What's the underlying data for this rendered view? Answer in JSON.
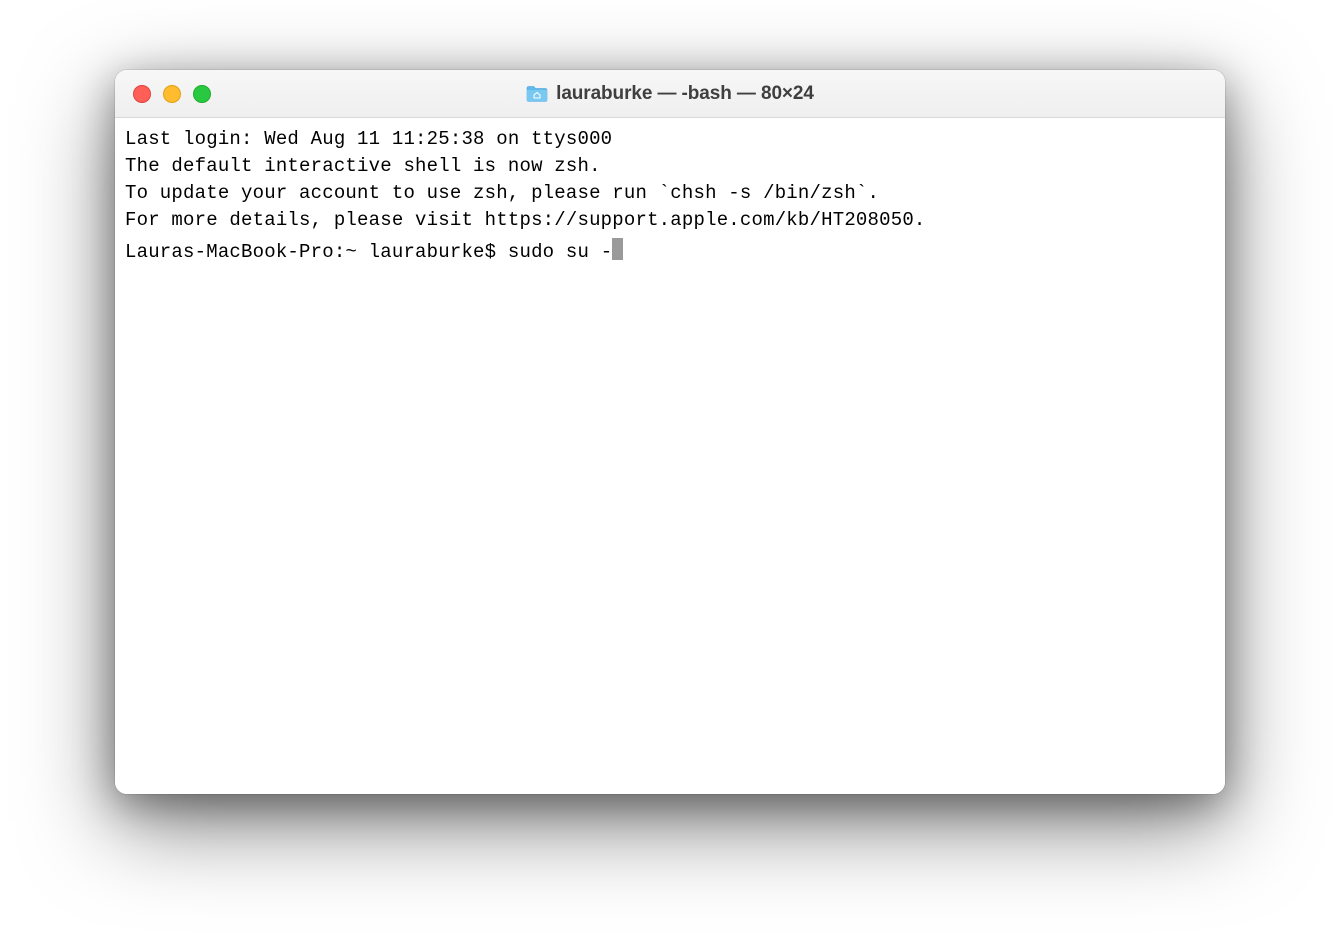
{
  "window": {
    "title": "lauraburke — -bash — 80×24"
  },
  "terminal": {
    "lines": [
      "Last login: Wed Aug 11 11:25:38 on ttys000",
      "",
      "The default interactive shell is now zsh.",
      "To update your account to use zsh, please run `chsh -s /bin/zsh`.",
      "For more details, please visit https://support.apple.com/kb/HT208050."
    ],
    "prompt": "Lauras-MacBook-Pro:~ lauraburke$ ",
    "command": "sudo su -"
  }
}
